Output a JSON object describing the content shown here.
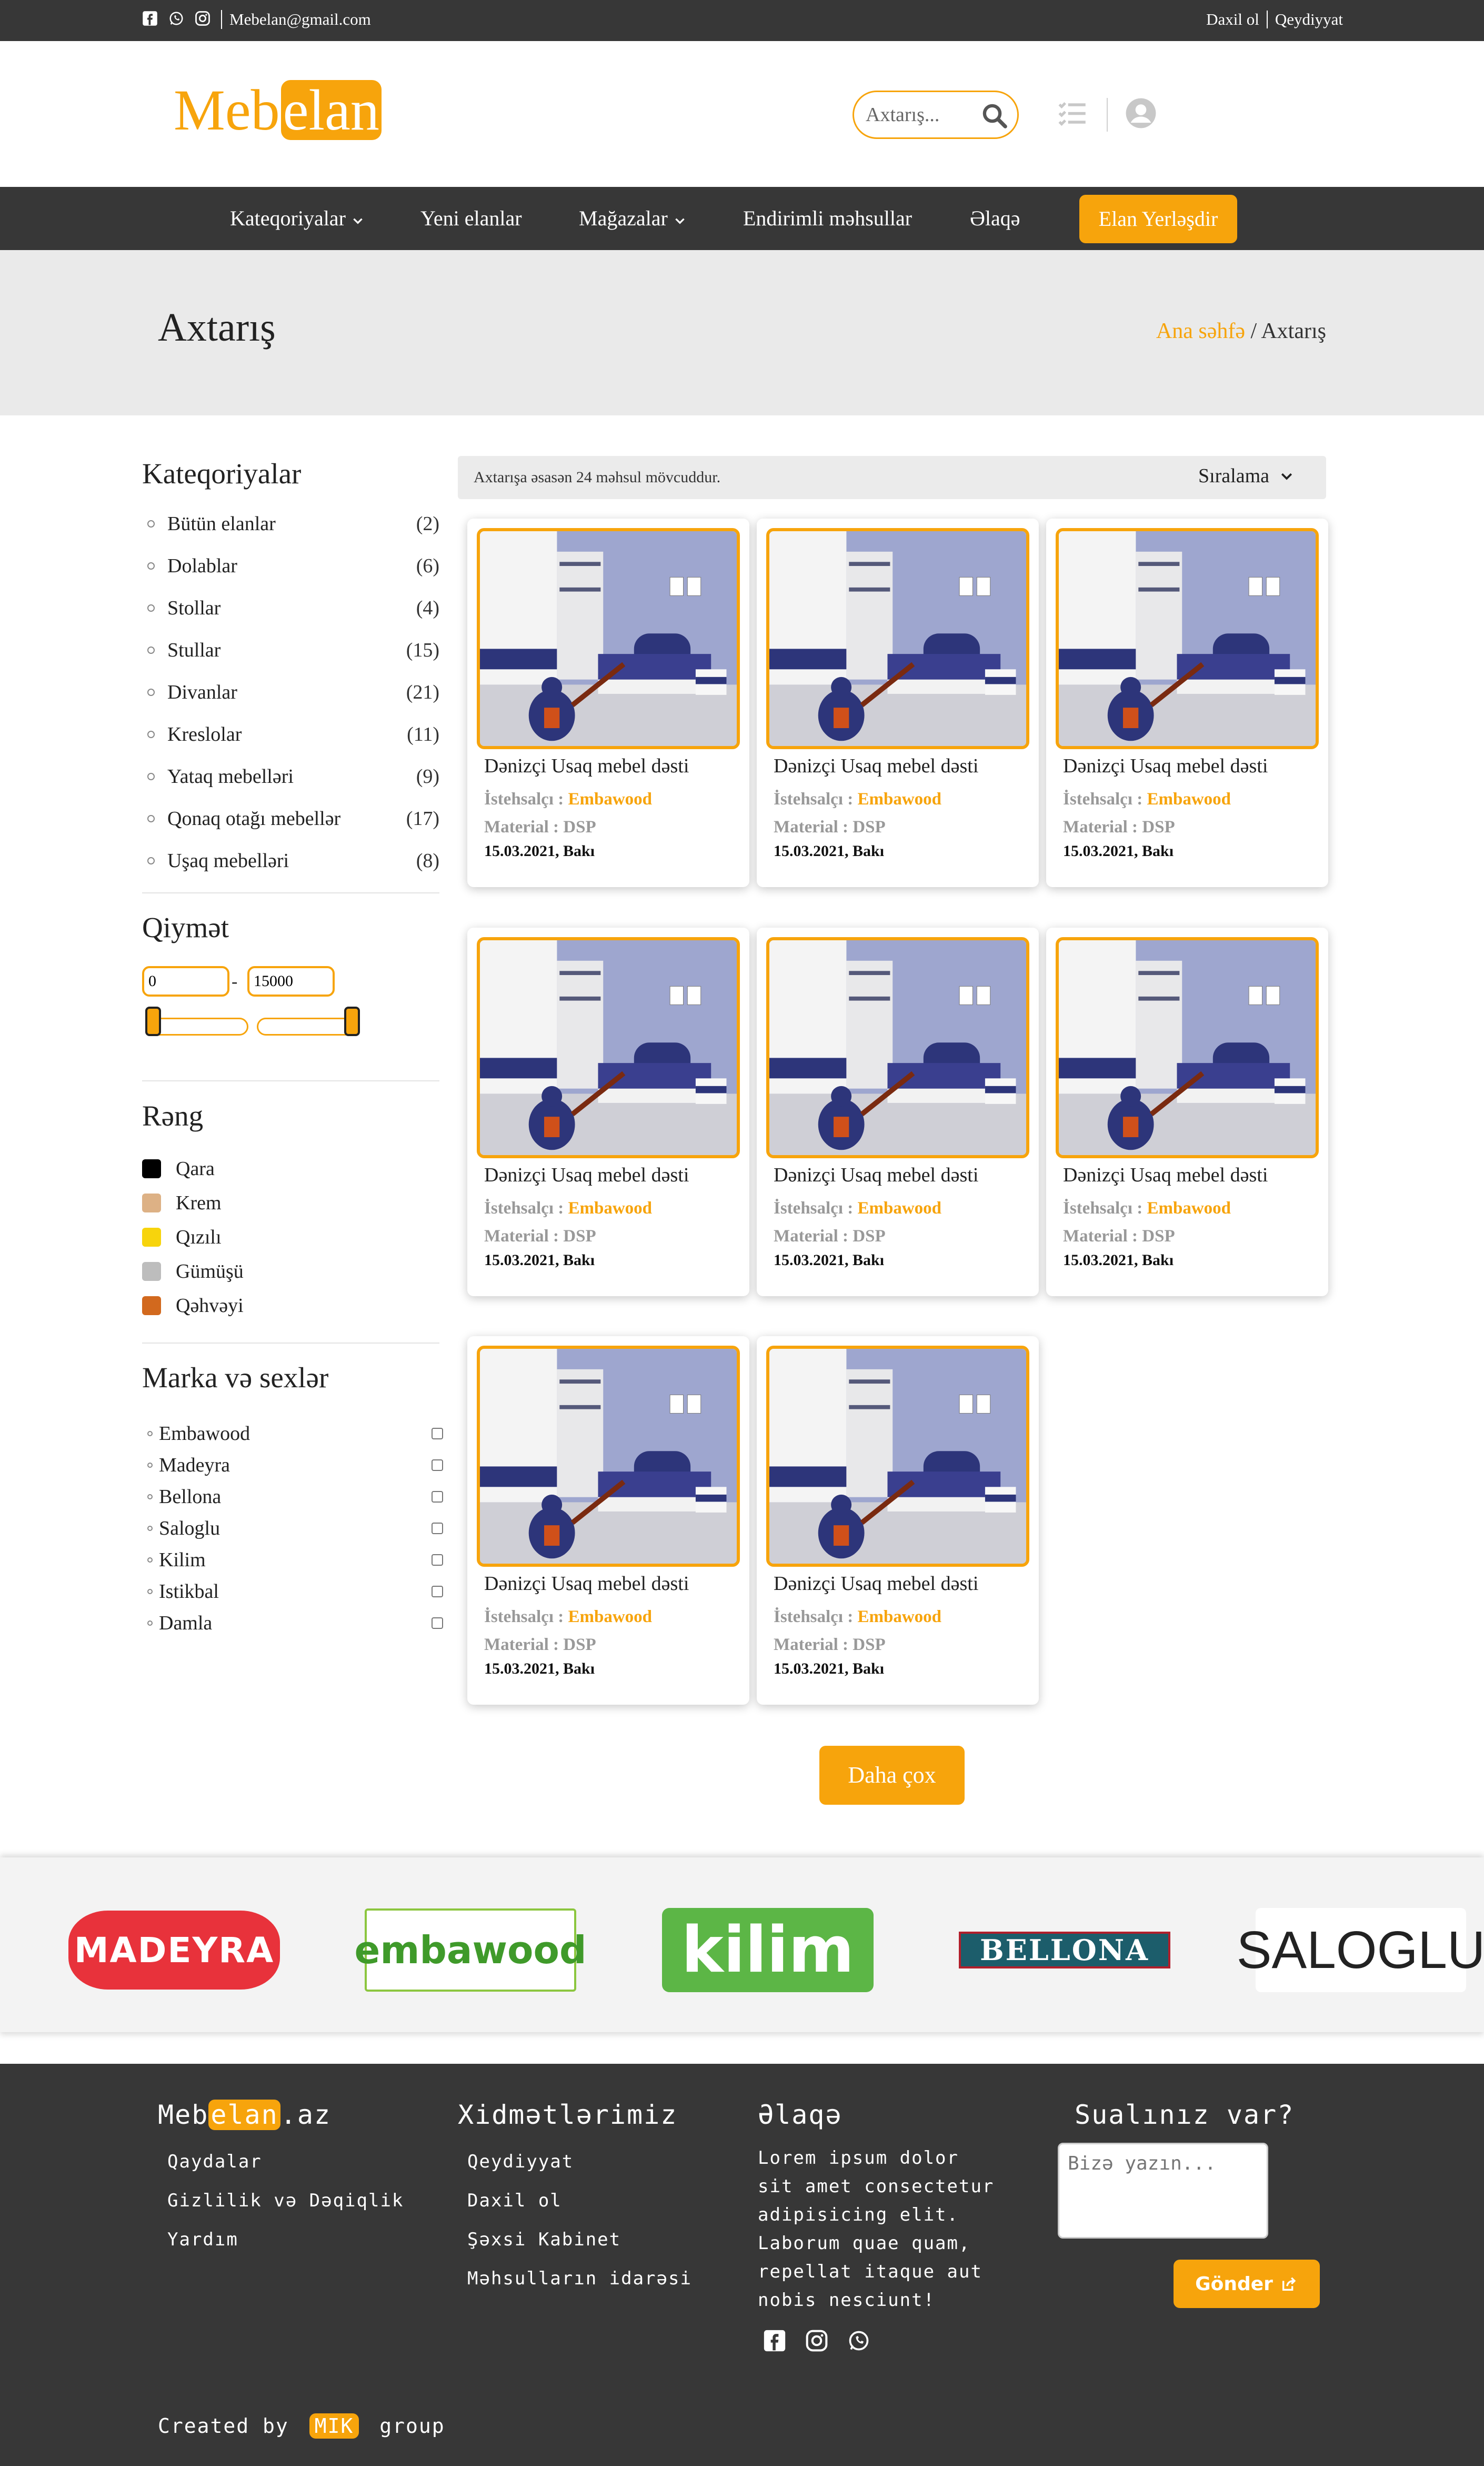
{
  "topbar": {
    "email": "Mebelan@gmail.com",
    "login": "Daxil ol",
    "register": "Qeydiyyat",
    "social_icons": [
      "facebook-icon",
      "whatsapp-icon",
      "instagram-icon"
    ]
  },
  "header": {
    "logo_prefix": "Meb",
    "logo_highlight": "elan",
    "search_placeholder": "Axtarış...",
    "icons": [
      "search-icon",
      "list-icon",
      "user-icon"
    ]
  },
  "nav": {
    "items": [
      "Kateqoriyalar",
      "Yeni elanlar",
      "Mağazalar",
      "Endirimli məhsullar",
      "Əlaqə"
    ],
    "cta": "Elan Yerləşdir"
  },
  "banner": {
    "title": "Axtarış",
    "crumb_home": "Ana səhfə",
    "crumb_sep": " / ",
    "crumb_current": "Axtarış"
  },
  "sidebar": {
    "categories_title": "Kateqoriyalar",
    "categories": [
      {
        "label": "Bütün elanlar",
        "count": "(2)"
      },
      {
        "label": "Dolablar",
        "count": "(6)"
      },
      {
        "label": "Stollar",
        "count": "(4)"
      },
      {
        "label": "Stullar",
        "count": "(15)"
      },
      {
        "label": "Divanlar",
        "count": "(21)"
      },
      {
        "label": "Kreslolar",
        "count": "(11)"
      },
      {
        "label": "Yataq mebelləri",
        "count": "(9)"
      },
      {
        "label": "Qonaq otağı mebellər",
        "count": "(17)"
      },
      {
        "label": "Uşaq mebelləri",
        "count": "(8)"
      }
    ],
    "price_title": "Qiymət",
    "price_min": "0",
    "price_max": "15000",
    "price_sep": "-",
    "color_title": "Rəng",
    "colors": [
      {
        "label": "Qara",
        "hex": "#000000"
      },
      {
        "label": "Krem",
        "hex": "#ddb185"
      },
      {
        "label": "Qızılı",
        "hex": "#f7d40c"
      },
      {
        "label": "Gümüşü",
        "hex": "#bdbdbd"
      },
      {
        "label": "Qəhvəyi",
        "hex": "#d2691e"
      }
    ],
    "brands_title": "Marka və sexlər",
    "brands": [
      "Embawood",
      "Madeyra",
      "Bellona",
      "Saloglu",
      "Kilim",
      "Istikbal",
      "Damla"
    ]
  },
  "results": {
    "count_text": "Axtarışa əsasən 24 məhsul mövcuddur.",
    "sort_label": "Sıralama",
    "more_button": "Daha çox",
    "cards": [
      {
        "title": "Dənizçi Usaq mebel dəsti",
        "maker_label": "İstehsalçı : ",
        "maker": "Embawood",
        "material": "Material : DSP",
        "date": "15.03.2021, Bakı"
      },
      {
        "title": "Dənizçi Usaq mebel dəsti",
        "maker_label": "İstehsalçı : ",
        "maker": "Embawood",
        "material": "Material : DSP",
        "date": "15.03.2021, Bakı"
      },
      {
        "title": "Dənizçi Usaq mebel dəsti",
        "maker_label": "İstehsalçı : ",
        "maker": "Embawood",
        "material": "Material : DSP",
        "date": "15.03.2021, Bakı"
      },
      {
        "title": "Dənizçi Usaq mebel dəsti",
        "maker_label": "İstehsalçı : ",
        "maker": "Embawood",
        "material": "Material : DSP",
        "date": "15.03.2021, Bakı"
      },
      {
        "title": "Dənizçi Usaq mebel dəsti",
        "maker_label": "İstehsalçı : ",
        "maker": "Embawood",
        "material": "Material : DSP",
        "date": "15.03.2021, Bakı"
      },
      {
        "title": "Dənizçi Usaq mebel dəsti",
        "maker_label": "İstehsalçı : ",
        "maker": "Embawood",
        "material": "Material : DSP",
        "date": "15.03.2021, Bakı"
      },
      {
        "title": "Dənizçi Usaq mebel dəsti",
        "maker_label": "İstehsalçı : ",
        "maker": "Embawood",
        "material": "Material : DSP",
        "date": "15.03.2021, Bakı"
      },
      {
        "title": "Dənizçi Usaq mebel dəsti",
        "maker_label": "İstehsalçı : ",
        "maker": "Embawood",
        "material": "Material : DSP",
        "date": "15.03.2021, Bakı"
      }
    ]
  },
  "brand_strip": [
    "MADEYRA",
    "embawood",
    "kilim",
    "BELLONA",
    "SALOGLU"
  ],
  "footer": {
    "logo_prefix": "Meb",
    "logo_highlight": "elan",
    "logo_suffix": ".az",
    "col1": [
      "Qaydalar",
      "Gizlilik və Dəqiqlik",
      "Yardım"
    ],
    "services_title": "Xidmətlərimiz",
    "col2": [
      "Qeydiyyat",
      "Daxil ol",
      "Şəxsi Kabinet",
      "Məhsulların idarəsi"
    ],
    "contact_title": "Əlaqə",
    "contact_text": "Lorem ipsum dolor sit amet consectetur adipisicing elit. Laborum quae quam, repellat itaque aut nobis nesciunt!",
    "question_title": "Sualınız var?",
    "message_placeholder": "Bizə yazın...",
    "send_label": "Gönder",
    "credit_prefix": "Created by",
    "credit_highlight": "MIK",
    "credit_suffix": "group"
  },
  "colors": {
    "accent": "#f7a40c",
    "dark": "#373737",
    "banner": "#eaeaea"
  }
}
